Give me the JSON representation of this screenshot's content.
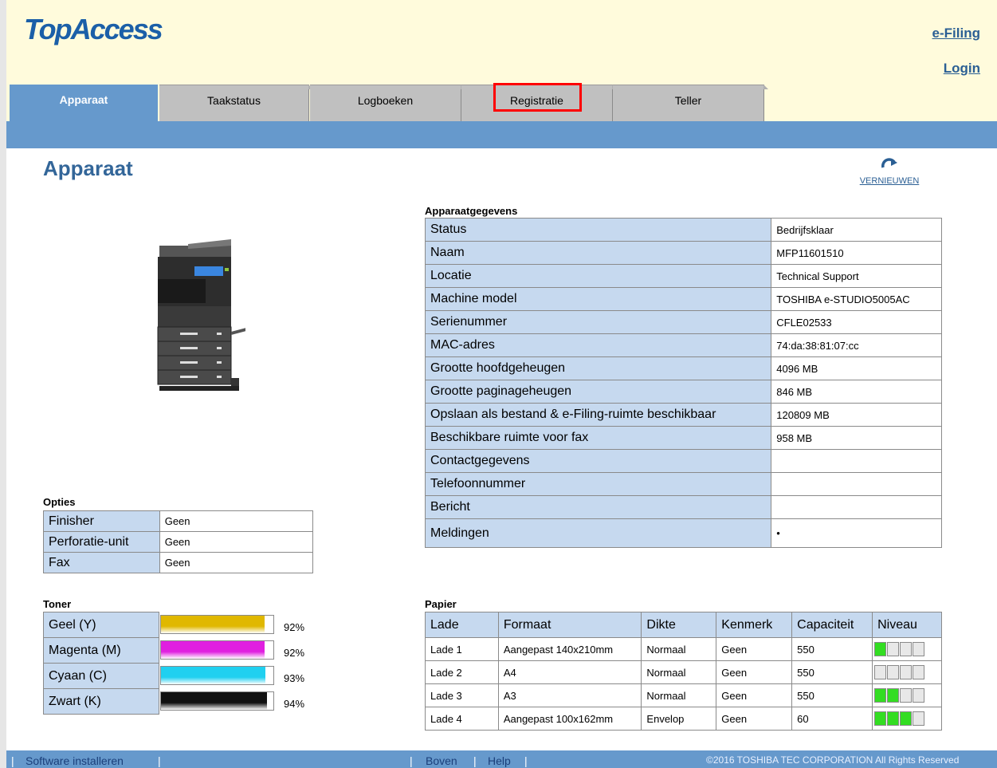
{
  "header": {
    "logo": "TopAccess",
    "efiling_link": "e-Filing",
    "login_link": "Login"
  },
  "tabs": [
    {
      "label": "Apparaat",
      "active": true
    },
    {
      "label": "Taakstatus"
    },
    {
      "label": "Logboeken"
    },
    {
      "label": "Registratie"
    },
    {
      "label": "Teller"
    }
  ],
  "page": {
    "title": "Apparaat",
    "refresh_label": "VERNIEUWEN"
  },
  "device_info": {
    "heading": "Apparaatgegevens",
    "rows": [
      {
        "key": "Status",
        "value": "Bedrijfsklaar"
      },
      {
        "key": "Naam",
        "value": "MFP11601510"
      },
      {
        "key": "Locatie",
        "value": "Technical Support"
      },
      {
        "key": "Machine model",
        "value": "TOSHIBA e-STUDIO5005AC"
      },
      {
        "key": "Serienummer",
        "value": "CFLE02533"
      },
      {
        "key": "MAC-adres",
        "value": "74:da:38:81:07:cc"
      },
      {
        "key": "Grootte hoofdgeheugen",
        "value": "4096 MB"
      },
      {
        "key": "Grootte paginageheugen",
        "value": "846 MB"
      },
      {
        "key": "Opslaan als bestand & e-Filing-ruimte beschikbaar",
        "value": "120809 MB"
      },
      {
        "key": "Beschikbare ruimte voor fax",
        "value": "958 MB"
      },
      {
        "key": "Contactgegevens",
        "value": ""
      },
      {
        "key": "Telefoonnummer",
        "value": ""
      },
      {
        "key": "Bericht",
        "value": ""
      },
      {
        "key": "Meldingen",
        "value": "•"
      }
    ]
  },
  "options": {
    "heading": "Opties",
    "rows": [
      {
        "key": "Finisher",
        "value": "Geen"
      },
      {
        "key": "Perforatie-unit",
        "value": "Geen"
      },
      {
        "key": "Fax",
        "value": "Geen"
      }
    ]
  },
  "toner": {
    "heading": "Toner",
    "rows": [
      {
        "key": "Geel (Y)",
        "percent": "92%",
        "level": 0.92,
        "color": "#e0b800"
      },
      {
        "key": "Magenta (M)",
        "percent": "92%",
        "level": 0.92,
        "color": "#e020e0"
      },
      {
        "key": "Cyaan (C)",
        "percent": "93%",
        "level": 0.93,
        "color": "#20d0f0"
      },
      {
        "key": "Zwart (K)",
        "percent": "94%",
        "level": 0.94,
        "color": "#111111"
      }
    ]
  },
  "paper": {
    "heading": "Papier",
    "columns": [
      "Lade",
      "Formaat",
      "Dikte",
      "Kenmerk",
      "Capaciteit",
      "Niveau"
    ],
    "rows": [
      {
        "lade": "Lade 1",
        "formaat": "Aangepast 140x210mm",
        "dikte": "Normaal",
        "kenmerk": "Geen",
        "capaciteit": "550",
        "niveau": 1
      },
      {
        "lade": "Lade 2",
        "formaat": "A4",
        "dikte": "Normaal",
        "kenmerk": "Geen",
        "capaciteit": "550",
        "niveau": 0
      },
      {
        "lade": "Lade 3",
        "formaat": "A3",
        "dikte": "Normaal",
        "kenmerk": "Geen",
        "capaciteit": "550",
        "niveau": 2
      },
      {
        "lade": "Lade 4",
        "formaat": "Aangepast 100x162mm",
        "dikte": "Envelop",
        "kenmerk": "Geen",
        "capaciteit": "60",
        "niveau": 3
      }
    ]
  },
  "footer": {
    "software": "Software installeren",
    "top": "Boven",
    "help": "Help",
    "copyright": "©2016 TOSHIBA TEC CORPORATION All Rights Reserved"
  }
}
